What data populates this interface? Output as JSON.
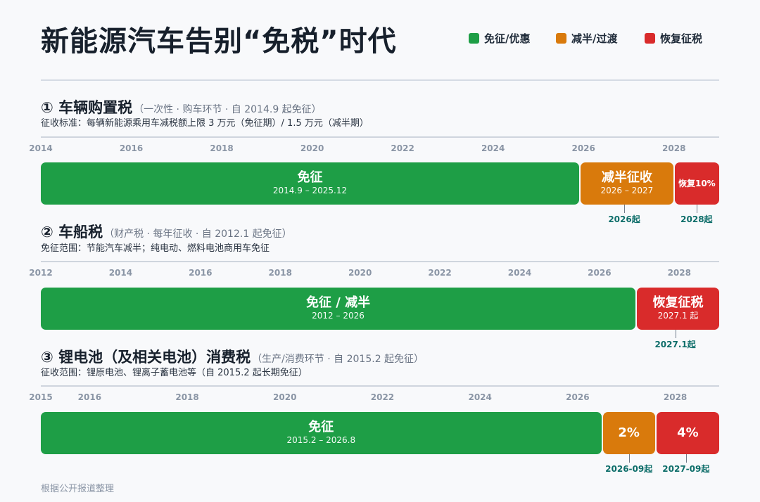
{
  "title": "新能源汽车告别“免税”时代",
  "legend": [
    {
      "label": "免征/优惠",
      "color": "#1e9e46"
    },
    {
      "label": "减半/过渡",
      "color": "#d97a0c"
    },
    {
      "label": "恢复征税",
      "color": "#d92b2b"
    }
  ],
  "source": "根据公开报道整理",
  "colors": {
    "green": "#1e9e46",
    "orange": "#d97a0c",
    "red": "#d92b2b"
  },
  "chart_data": [
    {
      "type": "bar",
      "title": "① 车辆购置税",
      "subtitle": "（一次性 · 购车环节 · 自 2014.9 起免征）",
      "description": "征收标准：每辆新能源乘用车减税额上限 3 万元（免征期）/ 1.5 万元（减半期）",
      "xlim": [
        2014,
        2029
      ],
      "ticks": [
        "2014",
        "2016",
        "2018",
        "2020",
        "2022",
        "2024",
        "2026",
        "2028"
      ],
      "segments": [
        {
          "label": "免征",
          "dates": "2014.9 – 2025.12",
          "start": 2014.0,
          "end": 2025.92,
          "color": "green"
        },
        {
          "label": "减半征收",
          "dates": "2026 – 2027",
          "start": 2025.92,
          "end": 2028.0,
          "color": "orange"
        },
        {
          "label": "恢复10%",
          "dates": "",
          "start": 2028.0,
          "end": 2029.0,
          "color": "red",
          "small": true
        }
      ],
      "markers": [
        {
          "label": "2026起",
          "x": 2026.9
        },
        {
          "label": "2028起",
          "x": 2028.5
        }
      ]
    },
    {
      "type": "bar",
      "title": "② 车船税",
      "subtitle": "（财产税 · 每年征收 · 自 2012.1 起免征）",
      "description": "免征范围：节能汽车减半；纯电动、燃料电池商用车免征",
      "xlim": [
        2012,
        2029
      ],
      "ticks": [
        "2012",
        "2014",
        "2016",
        "2018",
        "2020",
        "2022",
        "2024",
        "2026",
        "2028"
      ],
      "segments": [
        {
          "label": "免征 / 减半",
          "dates": "2012 – 2026",
          "start": 2012.0,
          "end": 2026.92,
          "color": "green"
        },
        {
          "label": "恢复征税",
          "dates": "2027.1 起",
          "start": 2026.92,
          "end": 2029.0,
          "color": "red"
        }
      ],
      "markers": [
        {
          "label": "2027.1起",
          "x": 2027.9
        }
      ]
    },
    {
      "type": "bar",
      "title": "③ 锂电池（及相关电池）消费税",
      "subtitle": "（生产/消费环节 · 自 2015.2 起免征）",
      "description": "征收范围：锂原电池、锂离子蓄电池等（自 2015.2 起长期免征）",
      "xlim": [
        2015,
        2028.9
      ],
      "ticks": [
        "2015",
        "2016",
        "2018",
        "2020",
        "2022",
        "2024",
        "2026",
        "2028"
      ],
      "segments": [
        {
          "label": "免征",
          "dates": "2015.2 – 2026.8",
          "start": 2015.0,
          "end": 2026.5,
          "color": "green"
        },
        {
          "label": "2%",
          "dates": "",
          "start": 2026.5,
          "end": 2027.6,
          "color": "orange"
        },
        {
          "label": "4%",
          "dates": "",
          "start": 2027.6,
          "end": 2028.9,
          "color": "red"
        }
      ],
      "markers": [
        {
          "label": "2026-09起",
          "x": 2027.05
        },
        {
          "label": "2027-09起",
          "x": 2028.22
        }
      ]
    }
  ]
}
